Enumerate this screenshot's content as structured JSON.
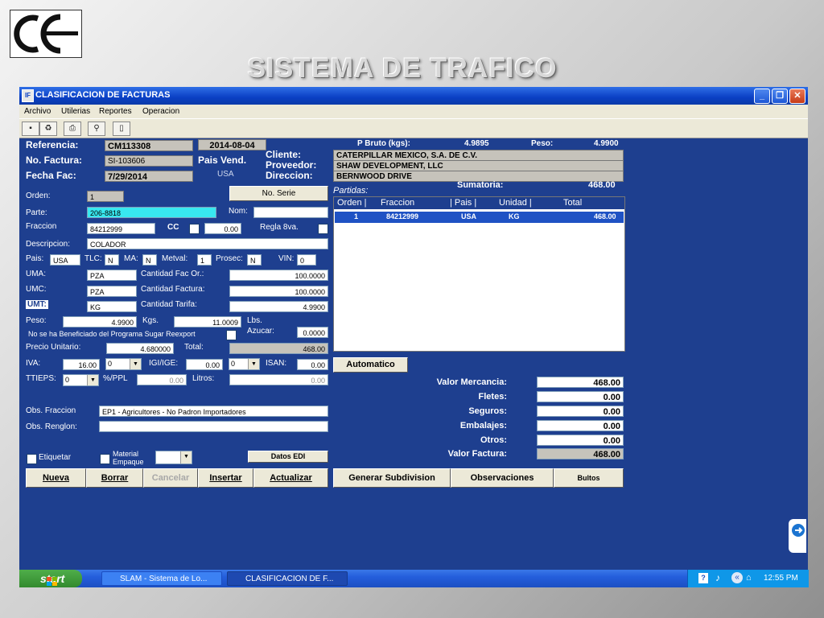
{
  "slide": {
    "title": "SISTEMA DE TRAFICO"
  },
  "window": {
    "title": "CLASIFICACION DE FACTURAS"
  },
  "menu": [
    "Archivo",
    "Utilerias",
    "Reportes",
    "Operacion"
  ],
  "header": {
    "referencia_label": "Referencia:",
    "referencia": "CM113308",
    "fecha_top": "2014-08-04",
    "factura_label": "No. Factura:",
    "factura": "SI-103606",
    "pais_vend_label": "Pais Vend.",
    "pais_vend": "USA",
    "fecha_label": "Fecha Fac:",
    "fecha": "7/29/2014",
    "cliente_label": "Cliente:",
    "proveedor_label": "Proveedor:",
    "direccion_label": "Direccion:",
    "cliente": "CATERPILLAR MEXICO, S.A. DE C.V.",
    "proveedor": "SHAW DEVELOPMENT, LLC",
    "direccion": "BERNWOOD DRIVE",
    "pbruto_label": "P Bruto (kgs):",
    "pbruto": "4.9895",
    "peso_label": "Peso:",
    "peso": "4.9900",
    "sumatoria_label": "Sumatoria:",
    "sumatoria": "468.00"
  },
  "form": {
    "orden_label": "Orden:",
    "orden": "1",
    "no_serie": "No. Serie",
    "parte_label": "Parte:",
    "parte": "206-8818",
    "nom_label": "Nom:",
    "nom": "",
    "fraccion_label": "Fraccion",
    "fraccion": "84212999",
    "cc_label": "CC",
    "cc_value": "0.00",
    "regla_label": "Regla 8va.",
    "descripcion_label": "Descripcion:",
    "descripcion": "COLADOR",
    "pais_label": "Pais:",
    "pais": "USA",
    "tlc_label": "TLC:",
    "tlc": "N",
    "ma_label": "MA:",
    "ma": "N",
    "metval_label": "Metval:",
    "metval": "1",
    "prosec_label": "Prosec:",
    "prosec": "N",
    "vin_label": "VIN:",
    "vin": "0",
    "uma_label": "UMA:",
    "uma": "PZA",
    "cant_fac_or_label": "Cantidad Fac Or.:",
    "cant_fac_or": "100.0000",
    "umc_label": "UMC:",
    "umc": "PZA",
    "cant_factura_label": "Cantidad Factura:",
    "cant_factura": "100.0000",
    "umt_label": "UMT:",
    "umt": "KG",
    "cant_tarifa_label": "Cantidad Tarifa:",
    "cant_tarifa": "4.9900",
    "peso_label": "Peso:",
    "peso": "4.9900",
    "kgs_label": "Kgs.",
    "lbs": "11.0009",
    "lbs_label": "Lbs.",
    "sugar_label": "No se ha Beneficiado del Programa Sugar Reexport",
    "azucar_label": "Azucar:",
    "azucar": "0.0000",
    "precio_label": "Precio Unitario:",
    "precio": "4.680000",
    "total_label": "Total:",
    "total": "468.00",
    "iva_label": "IVA:",
    "iva": "16.00",
    "iva_dd": "0",
    "igi_label": "IGI/IGE:",
    "igi": "0.00",
    "igi_dd": "0",
    "isan_label": "ISAN:",
    "isan": "0.00",
    "ttieps_label": "TTIEPS:",
    "ttieps_dd": "0",
    "ppl_label": "%/PPL",
    "ppl": "0.00",
    "litros_label": "Litros:",
    "litros": "0.00",
    "obs_fraccion_label": "Obs. Fraccion",
    "obs_fraccion": "EP1 - Agricultores - No Padron Importadores",
    "obs_renglon_label": "Obs. Renglon:",
    "obs_renglon": "",
    "etiquetar_label": "Etiquetar",
    "material_label1": "Material",
    "material_label2": "Empaque",
    "datos_edi": "Datos EDI"
  },
  "actions": {
    "nueva": "Nueva",
    "borrar": "Borrar",
    "cancelar": "Cancelar",
    "insertar": "Insertar",
    "actualizar": "Actualizar"
  },
  "partidas": {
    "label": "Partidas:",
    "headers": [
      "Orden |",
      "Fraccion",
      "| Pais |",
      "Unidad |",
      "Total"
    ],
    "rows": [
      [
        "1",
        "84212999",
        "USA",
        "KG",
        "468.00"
      ]
    ]
  },
  "totals": {
    "automatico": "Automatico",
    "valor_mercancia_label": "Valor Mercancia:",
    "valor_mercancia": "468.00",
    "fletes_label": "Fletes:",
    "fletes": "0.00",
    "seguros_label": "Seguros:",
    "seguros": "0.00",
    "embalajes_label": "Embalajes:",
    "embalajes": "0.00",
    "otros_label": "Otros:",
    "otros": "0.00",
    "valor_factura_label": "Valor Factura:",
    "valor_factura": "468.00"
  },
  "bottom_buttons": {
    "generar": "Generar Subdivision",
    "observaciones": "Observaciones",
    "bultos": "Bultos"
  },
  "taskbar": {
    "start": "start",
    "task1": "SLAM - Sistema de Lo...",
    "task2": "CLASIFICACION DE F...",
    "clock": "12:55 PM"
  }
}
